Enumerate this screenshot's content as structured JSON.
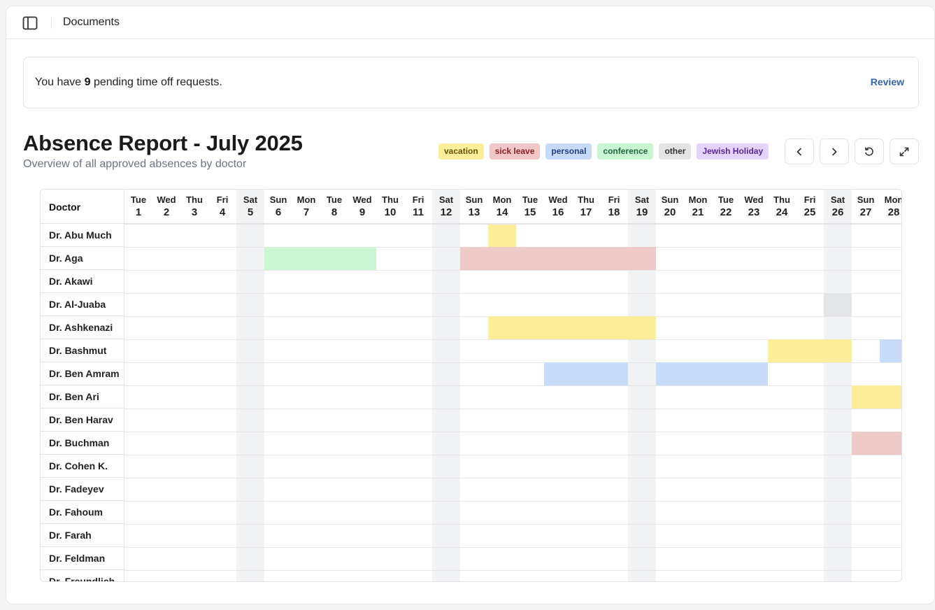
{
  "topbar": {
    "breadcrumb": "Documents",
    "toggle_icon": "sidebar-toggle-icon"
  },
  "pending": {
    "prefix": "You have ",
    "count": "9",
    "suffix": " pending time off requests.",
    "review_label": "Review"
  },
  "report": {
    "title": "Absence Report - July 2025",
    "subtitle": "Overview of all approved absences by doctor"
  },
  "legend": [
    {
      "key": "vacation",
      "label": "vacation",
      "bg": "#fbef9c",
      "fg": "#6b5200"
    },
    {
      "key": "sick",
      "label": "sick leave",
      "bg": "#f1c6c6",
      "fg": "#8d1f1f"
    },
    {
      "key": "personal",
      "label": "personal",
      "bg": "#c8daf9",
      "fg": "#1f3f8a"
    },
    {
      "key": "conference",
      "label": "conference",
      "bg": "#c9f5d3",
      "fg": "#1f6b35"
    },
    {
      "key": "other",
      "label": "other",
      "bg": "#e4e4e7",
      "fg": "#333333"
    },
    {
      "key": "jewish",
      "label": "Jewish Holiday",
      "bg": "#e4d3fb",
      "fg": "#5b2596"
    }
  ],
  "nav": {
    "prev_icon": "chevron-left-icon",
    "next_icon": "chevron-right-icon",
    "refresh_icon": "refresh-icon",
    "expand_icon": "expand-icon"
  },
  "colors": {
    "vacation": "#faee9a",
    "sick": "#f0c9c9",
    "personal": "#c9dbfa",
    "conference": "#cbf6d4",
    "other": "#e4e5e8",
    "weekend": "#f2f3f5"
  },
  "table": {
    "doctor_header": "Doctor",
    "days": [
      {
        "dow": "Tue",
        "num": "1"
      },
      {
        "dow": "Wed",
        "num": "2"
      },
      {
        "dow": "Thu",
        "num": "3"
      },
      {
        "dow": "Fri",
        "num": "4"
      },
      {
        "dow": "Sat",
        "num": "5",
        "weekend": true
      },
      {
        "dow": "Sun",
        "num": "6"
      },
      {
        "dow": "Mon",
        "num": "7"
      },
      {
        "dow": "Tue",
        "num": "8"
      },
      {
        "dow": "Wed",
        "num": "9"
      },
      {
        "dow": "Thu",
        "num": "10"
      },
      {
        "dow": "Fri",
        "num": "11"
      },
      {
        "dow": "Sat",
        "num": "12",
        "weekend": true
      },
      {
        "dow": "Sun",
        "num": "13"
      },
      {
        "dow": "Mon",
        "num": "14"
      },
      {
        "dow": "Tue",
        "num": "15"
      },
      {
        "dow": "Wed",
        "num": "16"
      },
      {
        "dow": "Thu",
        "num": "17"
      },
      {
        "dow": "Fri",
        "num": "18"
      },
      {
        "dow": "Sat",
        "num": "19",
        "weekend": true
      },
      {
        "dow": "Sun",
        "num": "20"
      },
      {
        "dow": "Mon",
        "num": "21"
      },
      {
        "dow": "Tue",
        "num": "22"
      },
      {
        "dow": "Wed",
        "num": "23"
      },
      {
        "dow": "Thu",
        "num": "24"
      },
      {
        "dow": "Fri",
        "num": "25"
      },
      {
        "dow": "Sat",
        "num": "26",
        "weekend": true
      },
      {
        "dow": "Sun",
        "num": "27"
      },
      {
        "dow": "Mon",
        "num": "28"
      }
    ],
    "doctors": [
      {
        "name": "Dr. Abu Much",
        "absences": [
          {
            "type": "vacation",
            "from": 14,
            "to": 14
          }
        ]
      },
      {
        "name": "Dr. Aga",
        "absences": [
          {
            "type": "conference",
            "from": 6,
            "to": 9
          },
          {
            "type": "sick",
            "from": 13,
            "to": 19
          }
        ]
      },
      {
        "name": "Dr. Akawi",
        "absences": []
      },
      {
        "name": "Dr. Al-Juaba",
        "absences": [
          {
            "type": "other",
            "from": 26,
            "to": 26
          }
        ]
      },
      {
        "name": "Dr. Ashkenazi",
        "absences": [
          {
            "type": "vacation",
            "from": 14,
            "to": 19
          }
        ]
      },
      {
        "name": "Dr. Bashmut",
        "absences": [
          {
            "type": "vacation",
            "from": 24,
            "to": 26
          },
          {
            "type": "personal",
            "from": 28,
            "to": 28
          }
        ]
      },
      {
        "name": "Dr. Ben Amram",
        "absences": [
          {
            "type": "personal",
            "from": 16,
            "to": 18
          },
          {
            "type": "personal",
            "from": 20,
            "to": 23
          }
        ]
      },
      {
        "name": "Dr. Ben Ari",
        "absences": [
          {
            "type": "vacation",
            "from": 27,
            "to": 28
          }
        ]
      },
      {
        "name": "Dr. Ben Harav",
        "absences": []
      },
      {
        "name": "Dr. Buchman",
        "absences": [
          {
            "type": "sick",
            "from": 27,
            "to": 28
          }
        ]
      },
      {
        "name": "Dr. Cohen K.",
        "absences": []
      },
      {
        "name": "Dr. Fadeyev",
        "absences": []
      },
      {
        "name": "Dr. Fahoum",
        "absences": []
      },
      {
        "name": "Dr. Farah",
        "absences": []
      },
      {
        "name": "Dr. Feldman",
        "absences": []
      },
      {
        "name": "Dr. Freundlich",
        "absences": []
      }
    ]
  }
}
